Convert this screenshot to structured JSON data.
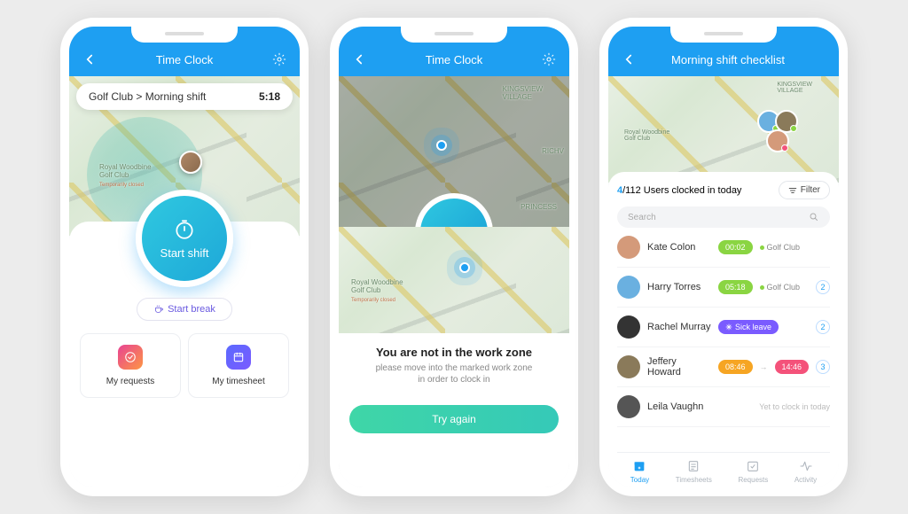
{
  "phone1": {
    "title": "Time Clock",
    "breadcrumb": "Golf Club > Morning shift",
    "time": "5:18",
    "map": {
      "poi": "Royal Woodbine\nGolf Club",
      "poi_note": "Temporarily closed"
    },
    "start_shift": "Start shift",
    "start_break": "Start break",
    "tiles": {
      "requests": "My requests",
      "timesheet": "My timesheet"
    }
  },
  "phone2": {
    "title": "Time Clock",
    "map_labels": {
      "kingsview": "KINGSVIEW\nVILLAGE",
      "richview": "RICHV",
      "princess": "PRINCESS"
    },
    "mini_map": {
      "poi": "Royal Woodbine\nGolf Club",
      "poi_note": "Temporarily closed"
    },
    "modal_title": "You are not in the work zone",
    "modal_sub": "please move into the marked work zone\nin order to clock in",
    "try_again": "Try again"
  },
  "phone3": {
    "title": "Morning shift checklist",
    "map": {
      "kingsview": "KINGSVIEW\nVILLAGE",
      "poi": "Royal Woodbine\nGolf Club"
    },
    "clocked_count": "4",
    "clocked_total": "/112",
    "clocked_label": " Users clocked in today",
    "filter": "Filter",
    "search_placeholder": "Search",
    "users": [
      {
        "name": "Kate Colon",
        "time": "00:02",
        "location": "Golf Club",
        "avatar": "#d49a7a"
      },
      {
        "name": "Harry Torres",
        "time": "05:18",
        "location": "Golf Club",
        "count": "2",
        "avatar": "#6ab0e0"
      },
      {
        "name": "Rachel Murray",
        "status": "Sick leave",
        "count": "2",
        "avatar": "#333"
      },
      {
        "name": "Jeffery Howard",
        "time_from": "08:46",
        "time_to": "14:46",
        "count": "3",
        "avatar": "#8a7a5a"
      },
      {
        "name": "Leila Vaughn",
        "note": "Yet to clock in today",
        "avatar": "#555"
      }
    ],
    "tabs": {
      "today": "Today",
      "timesheets": "Timesheets",
      "requests": "Requests",
      "activity": "Activity"
    }
  }
}
